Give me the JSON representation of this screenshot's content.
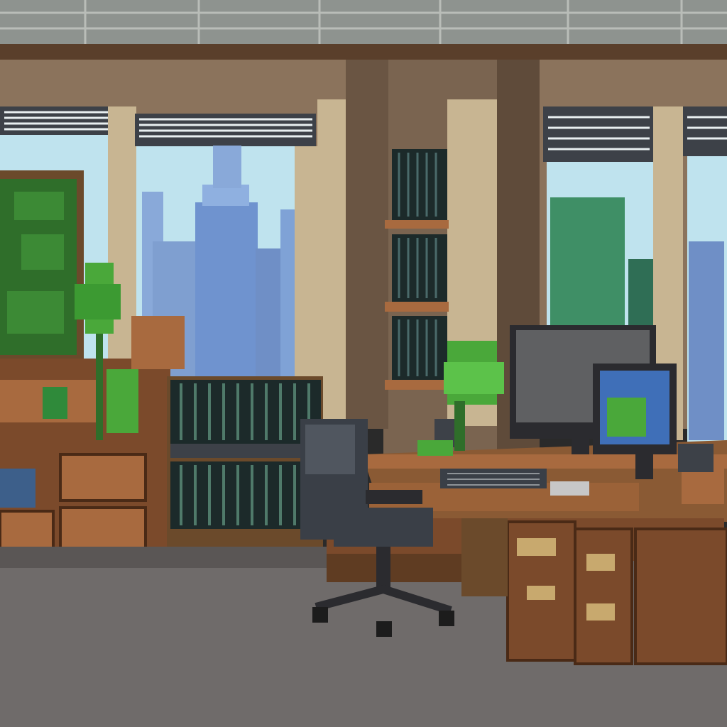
{
  "scene": {
    "title": "",
    "description_visible_text": ""
  },
  "palette": {
    "ceiling": "#8e938f",
    "ceiling_grid": "#b9bdb8",
    "wall": "#8b735c",
    "wall_dark": "#5f4b3a",
    "pillar": "#c8b592",
    "sky": "#bfe3ee",
    "sky_deep": "#89c3d9",
    "tower_blue": "#6f93cf",
    "tower_green": "#3f8f66",
    "wood": "#7b4a2b",
    "wood_light": "#a86a3f",
    "wood_dark": "#4a2a16",
    "floor": "#6f6b6a",
    "chair": "#3a3f47",
    "monitor_frame": "#2b2b2f",
    "screen_blue": "#3f6fb8",
    "plant": "#4aa83a",
    "plant_dark": "#2f6e2a",
    "books": "#1c2a2a"
  },
  "icons": {
    "monitor": "monitor-icon",
    "keyboard": "keyboard-icon",
    "chair": "office-chair-icon",
    "plant": "potted-plant-icon"
  }
}
